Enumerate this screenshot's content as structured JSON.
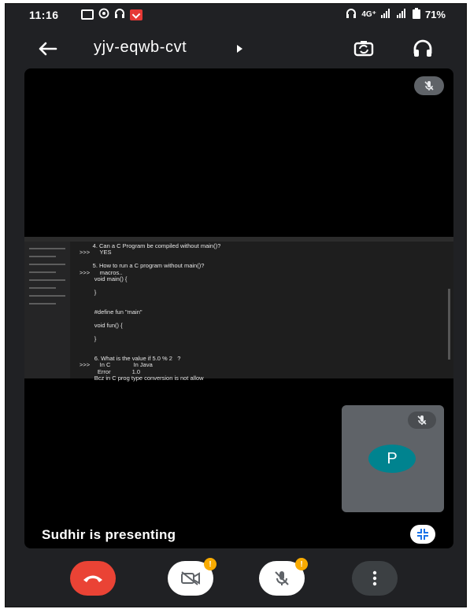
{
  "status_bar": {
    "time": "11:16",
    "network": "4G⁺",
    "battery": "71%",
    "icons": [
      "cast-icon",
      "whatsapp-icon",
      "headset-icon",
      "gmail-icon"
    ]
  },
  "app_bar": {
    "meeting_code": "yjv-eqwb-cvt",
    "icons": [
      "back-arrow-icon",
      "switch-camera-icon",
      "headphones-icon"
    ]
  },
  "shared_screen": {
    "code_lines": [
      "        4. Can a C Program be compiled without main()?",
      ">>>      YES",
      "",
      "        5. How to run a C program without main()?",
      ">>>      macros..",
      "         void main() {",
      "",
      "         }",
      "",
      "",
      "         #define fun \"main\"",
      "",
      "         void fun() {",
      "",
      "         }",
      "",
      "",
      "         6. What is the value if 5.0 % 2   ?",
      ">>>      In C              In Java",
      "           Error             1.0",
      "         Bcz in C prog type conversion is not allow"
    ]
  },
  "self_tile": {
    "avatar_initial": "P"
  },
  "presenting_label": "Sudhir is presenting",
  "controls": {
    "camera_badge": "!",
    "mic_badge": "!"
  },
  "colors": {
    "end_call": "#ea4335",
    "avatar": "#00838f",
    "badge": "#f9ab00",
    "background": "#202124"
  }
}
